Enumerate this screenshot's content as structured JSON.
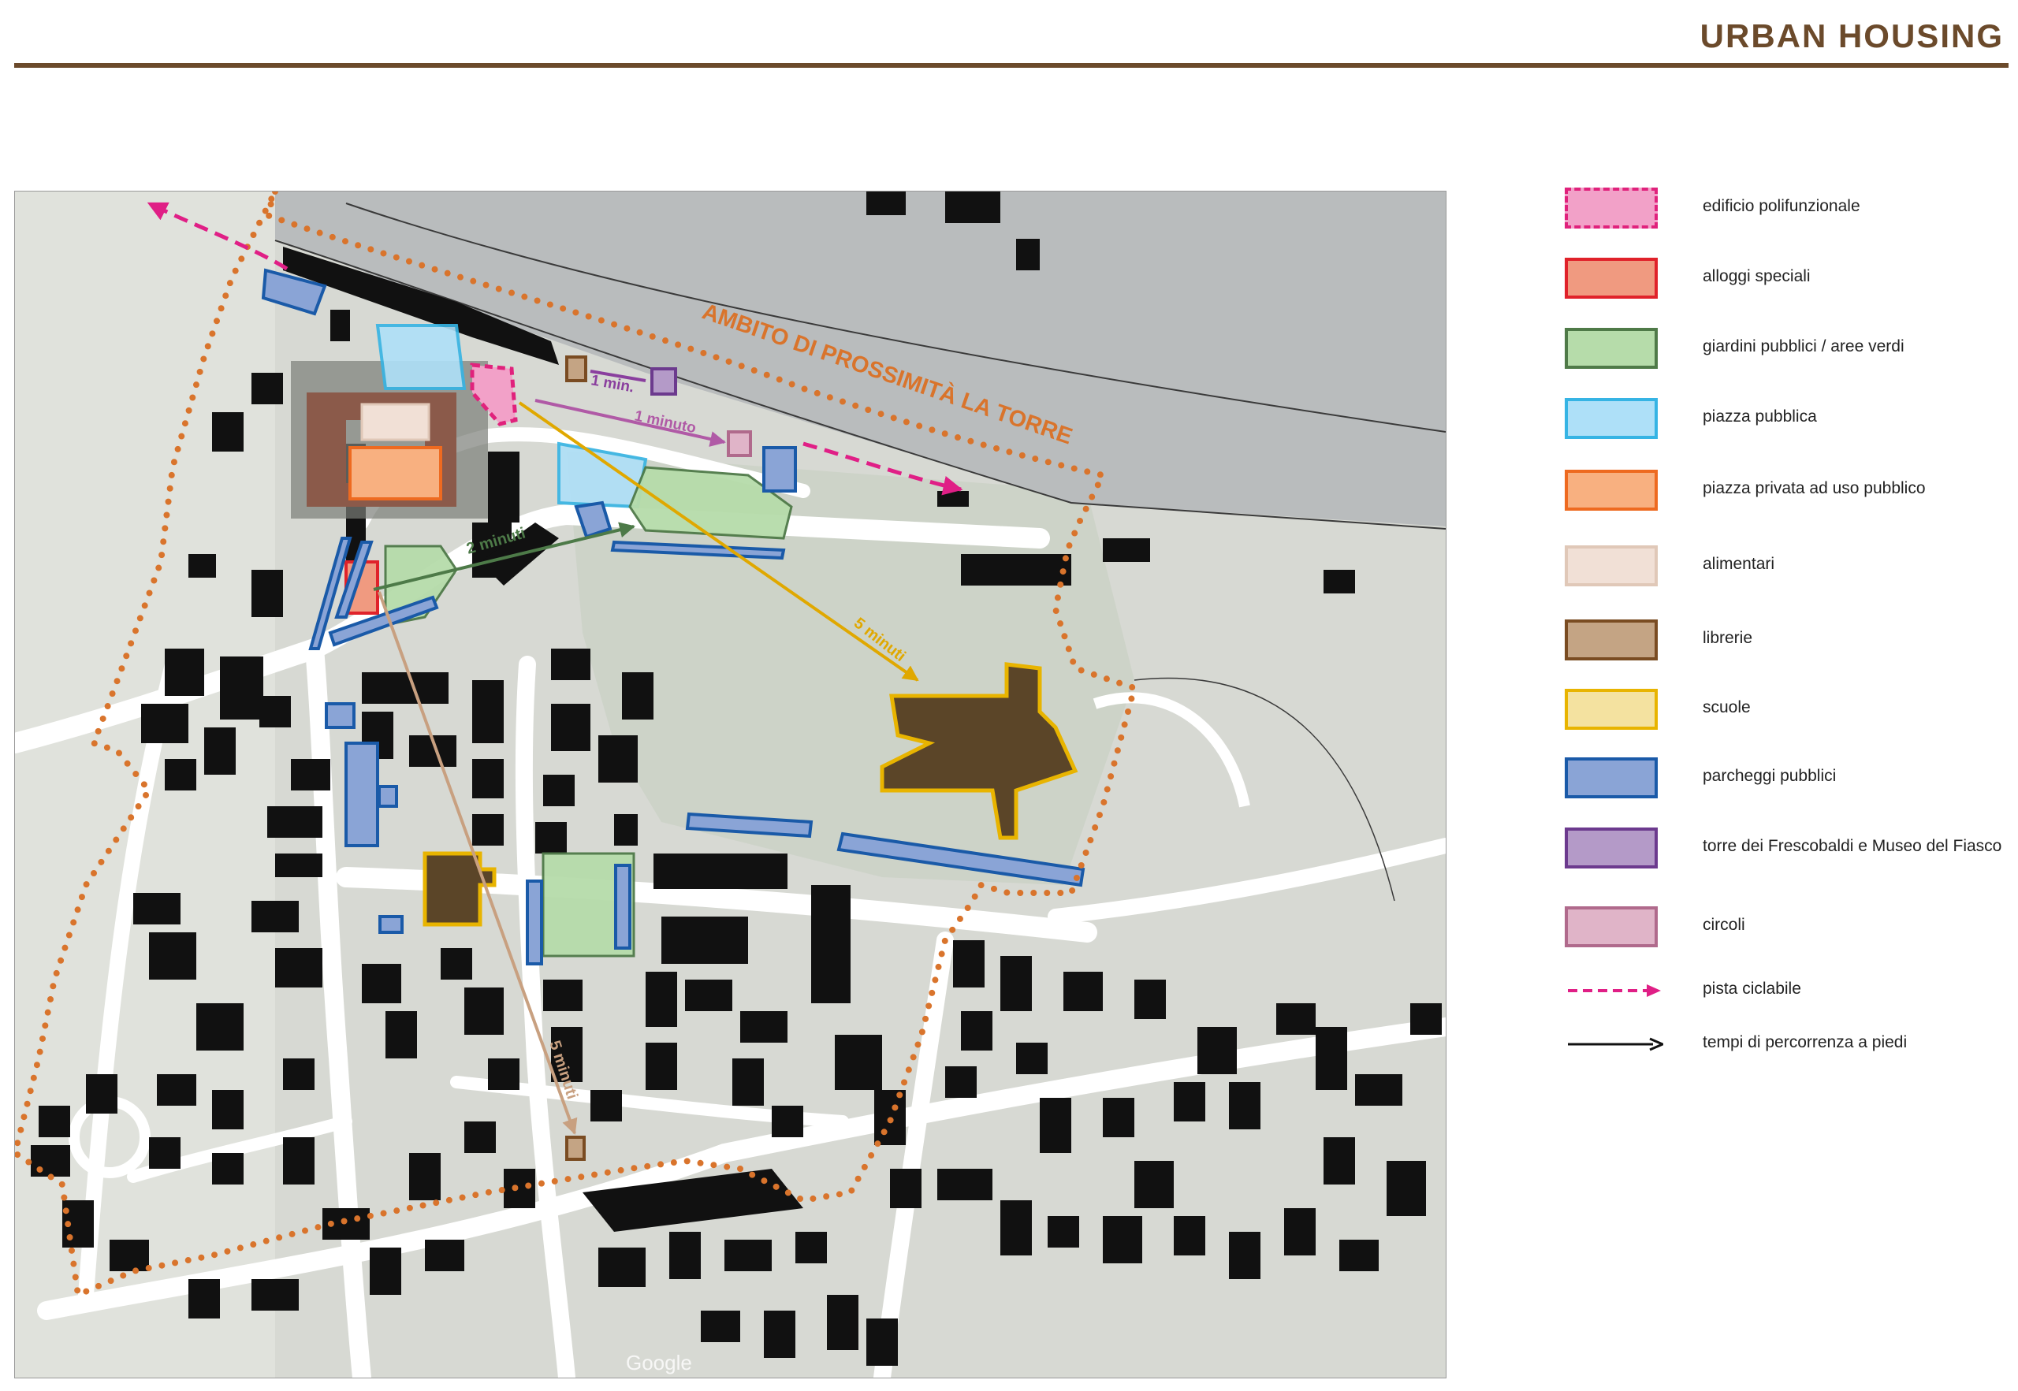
{
  "header": {
    "title": "URBAN HOUSING"
  },
  "map": {
    "area_label": "AMBITO DI PROSSIMITÀ LA TORRE",
    "walk_times": [
      {
        "text": "1 min.",
        "color": "#8a3f9e"
      },
      {
        "text": "1 minuto",
        "color": "#b05aa6"
      },
      {
        "text": "2 minuti",
        "color": "#4d7a48"
      },
      {
        "text": "5 minuti",
        "color": "#e0a800"
      },
      {
        "text": "5 minuti",
        "color": "#c8a080"
      }
    ],
    "watermark": "Google",
    "colors": {
      "boundary": "#d9742c",
      "buildings": "#111111",
      "river": "#b9bcbd",
      "roads": "#ffffff",
      "bike_path": "#e01f86"
    }
  },
  "legend": {
    "items": [
      {
        "label": "edificio polifunzionale",
        "fill": "#f2a1c8",
        "stroke": "#e0227c",
        "dashed": true
      },
      {
        "label": "alloggi speciali",
        "fill": "#f09a80",
        "stroke": "#e0222a",
        "dashed": false
      },
      {
        "label": "giardini pubblici / aree verdi",
        "fill": "#b6dcaa",
        "stroke": "#4f7a48",
        "dashed": false
      },
      {
        "label": "piazza pubblica",
        "fill": "#aee0f8",
        "stroke": "#36b4e4",
        "dashed": false
      },
      {
        "label": "piazza privata ad uso pubblico",
        "fill": "#f8b080",
        "stroke": "#ee6a20",
        "dashed": false
      },
      {
        "label": "alimentari",
        "fill": "#f1e0d6",
        "stroke": "#e0c8b8",
        "dashed": false
      },
      {
        "label": "librerie",
        "fill": "#c4a484",
        "stroke": "#7a4c22",
        "dashed": false
      },
      {
        "label": "scuole",
        "fill": "#f4e2a0",
        "stroke": "#e8b400",
        "dashed": false
      },
      {
        "label": "parcheggi pubblici",
        "fill": "#8aa4d6",
        "stroke": "#1a5aa8",
        "dashed": false
      },
      {
        "label": "torre dei Frescobaldi e Museo del Fiasco",
        "fill": "#b49ac8",
        "stroke": "#6c3a8e",
        "dashed": false
      },
      {
        "label": "circoli",
        "fill": "#e0b4c8",
        "stroke": "#b06a8c",
        "dashed": false
      },
      {
        "label": "pista ciclabile",
        "kind": "dashed-arrow",
        "stroke": "#e01f86"
      },
      {
        "label": "tempi di percorrenza a piedi",
        "kind": "arrow",
        "stroke": "#111111"
      }
    ]
  }
}
